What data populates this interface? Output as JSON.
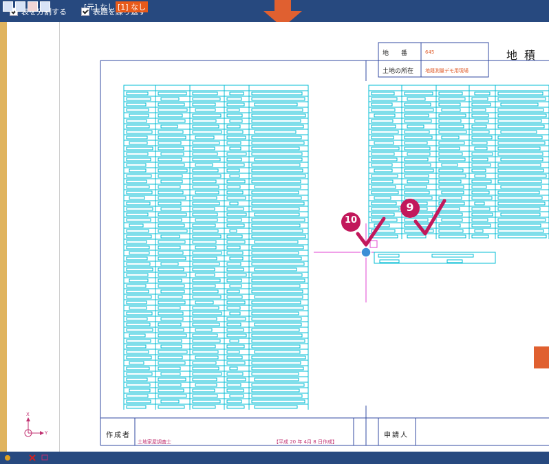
{
  "toolbar": {
    "split_table_label": "表を分割する",
    "repeat_header_label": "表題を繰り返す"
  },
  "sheet": {
    "lot_number_label": "地　　番",
    "lot_number_value": "645",
    "title_partial": "地積",
    "location_label": "土地の所在",
    "location_value": "地籍測量デモ用現場",
    "creator_label": "作成者",
    "creator_value": "土地家屋調査士",
    "date_text": "【平成 20 年 4月 8 日作成】",
    "applicant_label": "申請人"
  },
  "annotations": {
    "step_9": "9",
    "step_10": "10"
  },
  "axis": {
    "x_label": "X",
    "y_label": "Y"
  },
  "statusbar": {
    "source_text": "[元] なし",
    "current_layer_text": "[1] なし"
  },
  "colors": {
    "bar": "#27497f",
    "cyan": "#00bcd4",
    "magenta": "#e040d0",
    "orange": "#e06030",
    "checkmark": "#c2185b"
  }
}
